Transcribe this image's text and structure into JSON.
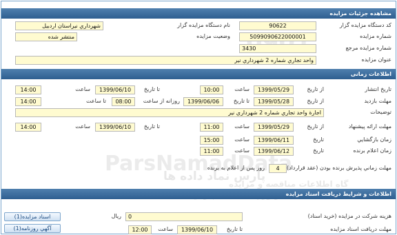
{
  "details_header": "مشاهده جزئيات مزايده",
  "auction_code": {
    "label": "كد دستگاه مزايده گزار",
    "value": "90622"
  },
  "organizer": {
    "label": "نام دستگاه مزايده گزار",
    "value": "شهرداري نيراستان اردبيل"
  },
  "auction_number": {
    "label": "شماره مزايده",
    "value": "5099090622000001"
  },
  "auction_status": {
    "label": "وضعيت مزايده",
    "value": "منتشر شده"
  },
  "reference_number": {
    "label": "شماره مزايده مرجع",
    "value": "3430"
  },
  "auction_title": {
    "label": "عنوان مزايده",
    "value": "واحد تجاري شماره 2 شهرداري نير"
  },
  "timing_header": "اطلاعات زمانی",
  "common": {
    "from_date": "از تاريخ",
    "to_date": "تا تاريخ",
    "time": "ساعت",
    "to_time": "تا ساعت"
  },
  "publish": {
    "label": "تاريخ انتشار",
    "from_date": "1399/05/29",
    "from_time": "10:00",
    "to_date": "1399/06/10",
    "to_time": "14:00"
  },
  "visit": {
    "label": "مهلت بازديد",
    "from_date": "1399/05/28",
    "from_time": "14:00",
    "to_date": "1399/06/06",
    "daily_from_label": "روزانه از ساعت",
    "daily_from": "08:00"
  },
  "description": {
    "label": "توضيحات",
    "value": "اجارة واحد تجاري شماره 2 شهرداري نير"
  },
  "offer_deadline": {
    "label": "مهلت ارائه پيشنهاد",
    "from_date": "1399/05/29",
    "from_time": "11:00",
    "to_date": "1399/06/10",
    "to_time": "14:00"
  },
  "opening": {
    "label": "زمان بازگشايي",
    "date": "1399/06/11",
    "time": "15:00",
    "date_label": "تاريخ"
  },
  "winner_announce": {
    "label": "زمان اعلام برنده",
    "date": "1399/06/12",
    "time": "11:00",
    "date_label": "تاريخ"
  },
  "acceptance": {
    "label": "مهلت زماني پذيرش برنده بودن (عقد قرارداد)",
    "days": "4",
    "suffix": "روز پس از اعلام به برنده"
  },
  "documents_header": "اطلاعات و شرايط دريافت اسناد مزايده",
  "fee": {
    "label": "هزينه شركت در مزايده (خريد اسناد)",
    "value": "0",
    "unit": "ريال"
  },
  "doc_deadline": {
    "label": "مهلت دريافت اسناد مزايده",
    "to_date_label": "تا تاريخ",
    "date": "1399/06/10",
    "time_label": "ساعت",
    "time": "12:00"
  },
  "buttons": {
    "auction_docs": "اسناد مزايده(1)",
    "newspaper_ad": "آگهي روزنامه(1)"
  },
  "watermark": {
    "brand": "ParsNamadData",
    "persian_line1": "پارس نماد داده ها",
    "persian_line2": "گاه اطلاعات مناقصه و مزايده",
    "persian_line3": "فرآوري اطلاعات پارس نماد داده ها",
    "logo_number": "0901"
  }
}
